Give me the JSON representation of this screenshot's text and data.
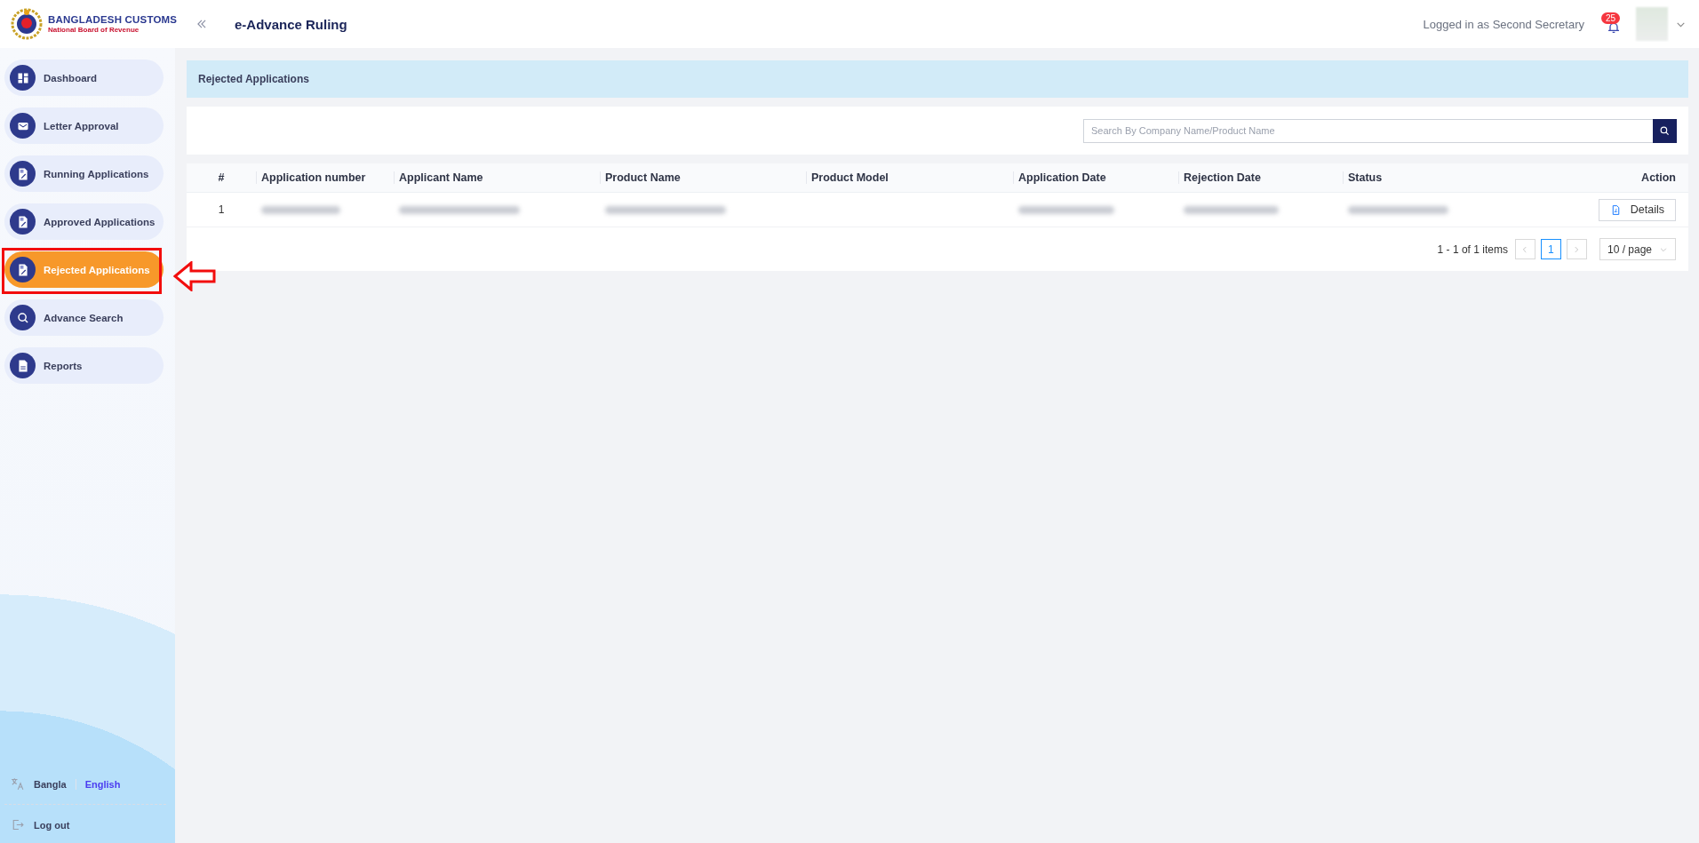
{
  "header": {
    "logo_title": "BANGLADESH CUSTOMS",
    "logo_subtitle": "National Board of Revenue",
    "app_title": "e-Advance Ruling",
    "user_text": "Logged in as Second Secretary",
    "notification_count": "25"
  },
  "sidebar": {
    "items": [
      {
        "label": "Dashboard",
        "kind": "grid",
        "selected": false,
        "highlighted": false
      },
      {
        "label": "Letter Approval",
        "kind": "mail",
        "selected": false,
        "highlighted": false
      },
      {
        "label": "Running Applications",
        "kind": "doc-edit",
        "selected": false,
        "highlighted": false
      },
      {
        "label": "Approved Applications",
        "kind": "doc-edit",
        "selected": false,
        "highlighted": false
      },
      {
        "label": "Rejected Applications",
        "kind": "doc-edit",
        "selected": true,
        "highlighted": true
      },
      {
        "label": "Advance Search",
        "kind": "search",
        "selected": false,
        "highlighted": false
      },
      {
        "label": "Reports",
        "kind": "doc",
        "selected": false,
        "highlighted": false
      }
    ],
    "languages": [
      {
        "label": "Bangla",
        "selected": false
      },
      {
        "label": "English",
        "selected": true
      }
    ],
    "logout": "Log out"
  },
  "page_title": "Rejected Applications",
  "search": {
    "placeholder": "Search By Company Name/Product Name"
  },
  "table": {
    "columns": [
      "#",
      "Application number",
      "Applicant Name",
      "Product Name",
      "Product Model",
      "Application Date",
      "Rejection Date",
      "Status",
      "Action"
    ],
    "rows": [
      {
        "number": "1",
        "cells": [
          {
            "kind": "redacted"
          },
          {
            "kind": "redacted"
          },
          {
            "kind": "redacted"
          },
          {
            "kind": "empty"
          },
          {
            "kind": "redacted"
          },
          {
            "kind": "redacted"
          },
          {
            "kind": "redacted"
          }
        ],
        "action": "Details"
      }
    ]
  },
  "pagination": {
    "summary": "1 - 1 of 1 items",
    "pages": [
      {
        "label": "1",
        "selected": true
      }
    ],
    "page_size": "10 / page"
  }
}
